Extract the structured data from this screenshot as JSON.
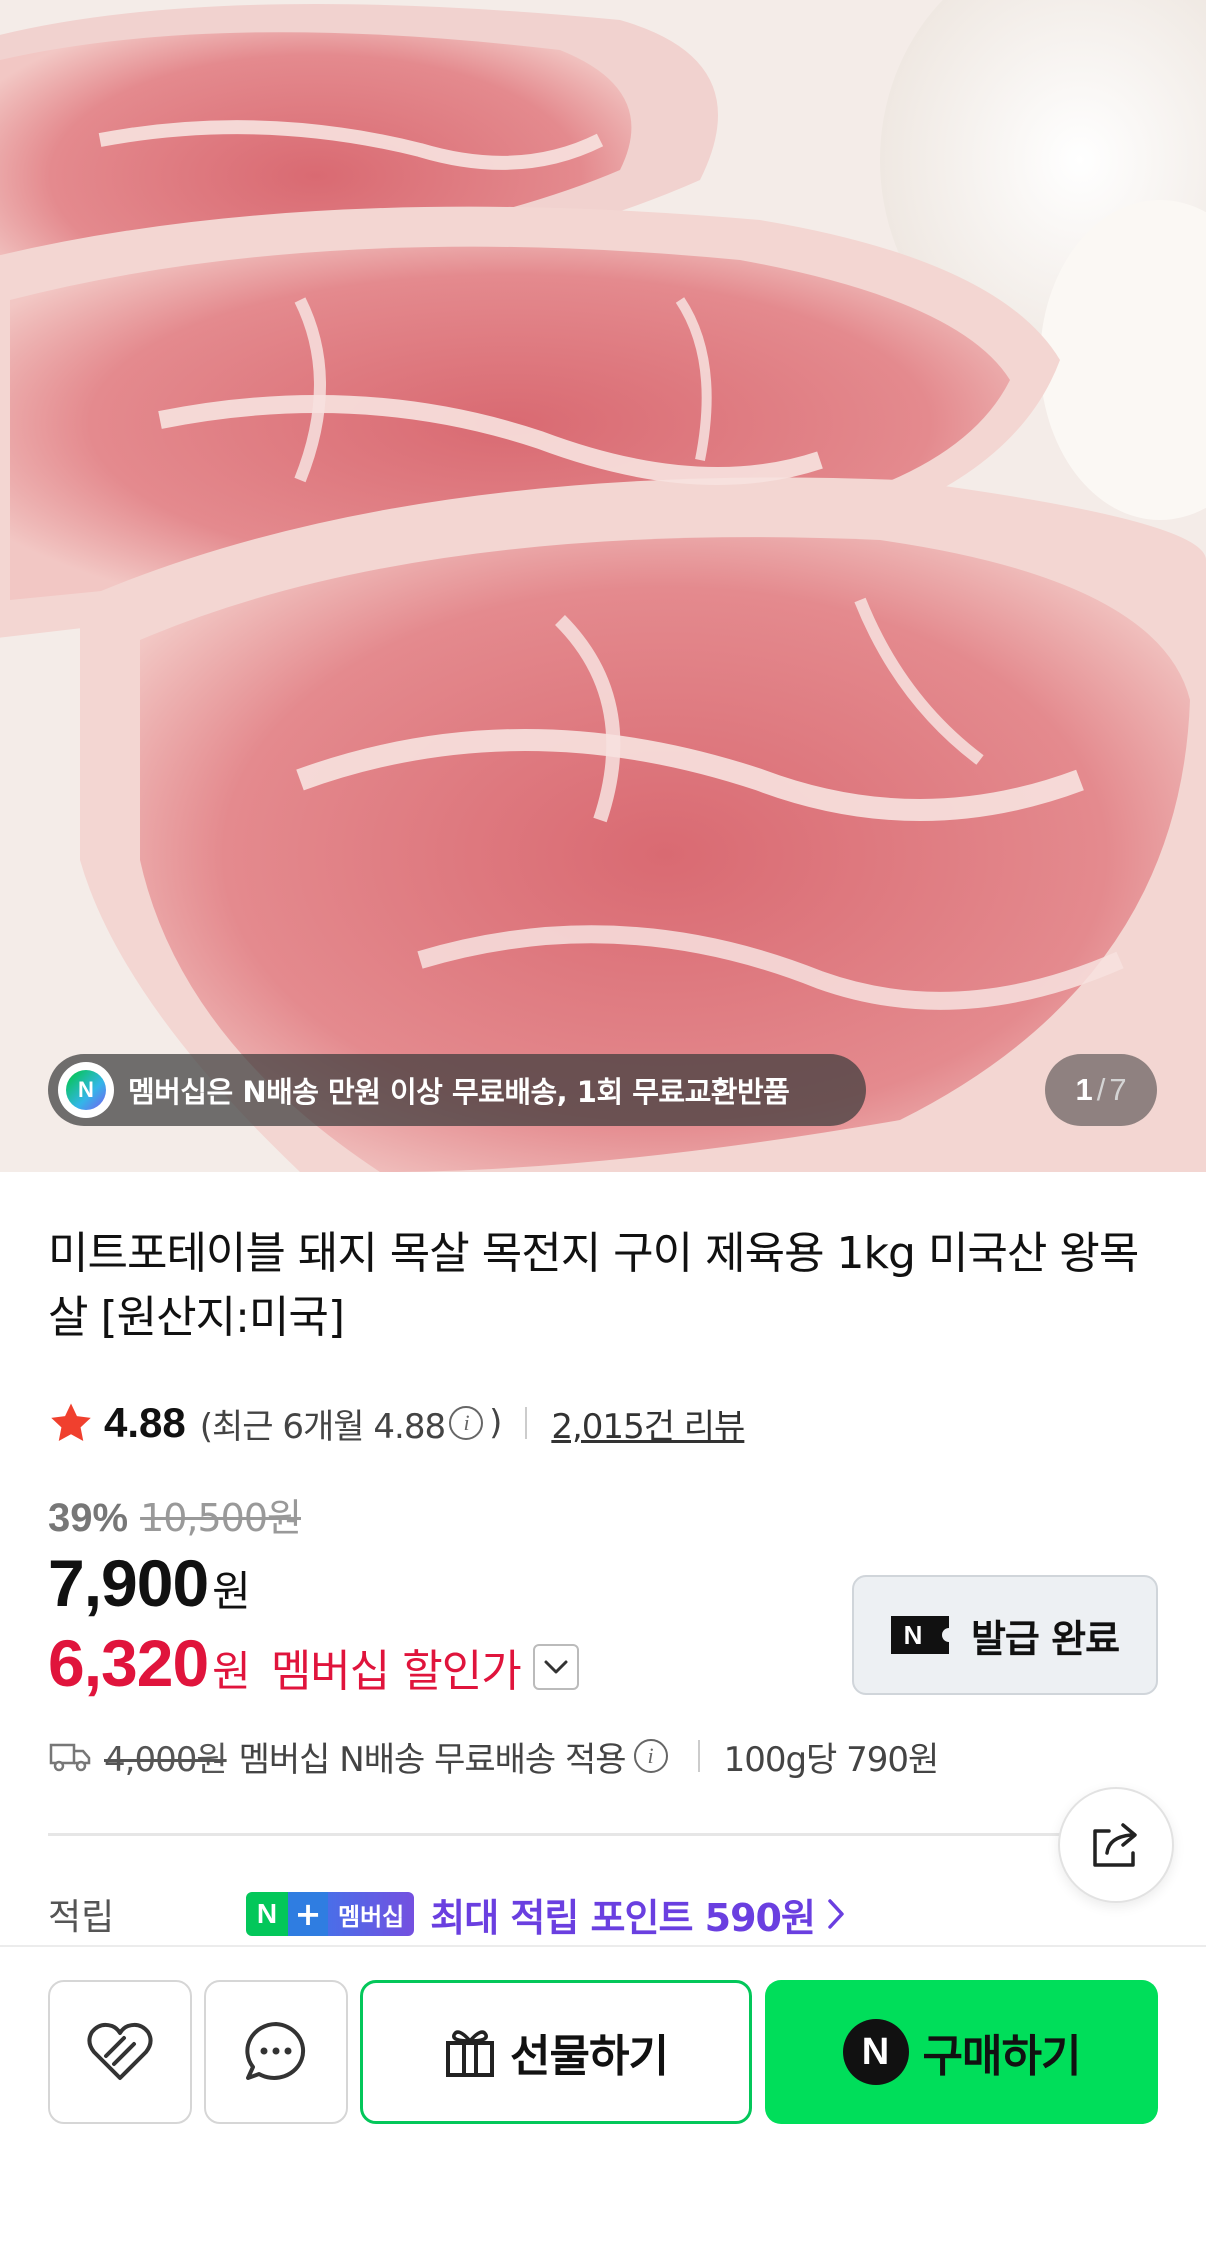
{
  "hero": {
    "image_alt": "돼지 목살 이미지",
    "promo_icon_letter": "N",
    "promo_text": "멤버십은 N배송 만원 이상 무료배송, 1회 무료교환반품",
    "counter_current": "1",
    "counter_sep": "/",
    "counter_total": "7"
  },
  "product": {
    "title": "미트포테이블 돼지 목살 목전지 구이 제육용 1kg 미국산 왕목살 [원산지:미국]",
    "rating": "4.88",
    "recent_rating_prefix": "(최근 6개월 4.88",
    "recent_rating_suffix": ")",
    "review_count": "2,015건 리뷰",
    "discount_pct": "39%",
    "original_price": "10,500원",
    "price": "7,900",
    "price_unit": "원",
    "member_price": "6,320",
    "member_price_unit": "원",
    "member_price_label": "멤버십 할인가",
    "coupon_label": "발급 완료",
    "shipping_original": "4,000원",
    "shipping_text": "멤버십 N배송 무료배송 적용",
    "unit_price": "100g당 790원",
    "points_label": "적립",
    "points_badge_n": "N",
    "points_badge_plus": "+",
    "points_badge_member": "멤버십",
    "points_text": "최대 적립 포인트 590원"
  },
  "bottom_bar": {
    "gift_label": "선물하기",
    "buy_n": "N",
    "buy_label": "구매하기"
  },
  "colors": {
    "accent_green": "#00de5a",
    "member_red": "#e0143c",
    "points_purple": "#6a3fe0"
  }
}
